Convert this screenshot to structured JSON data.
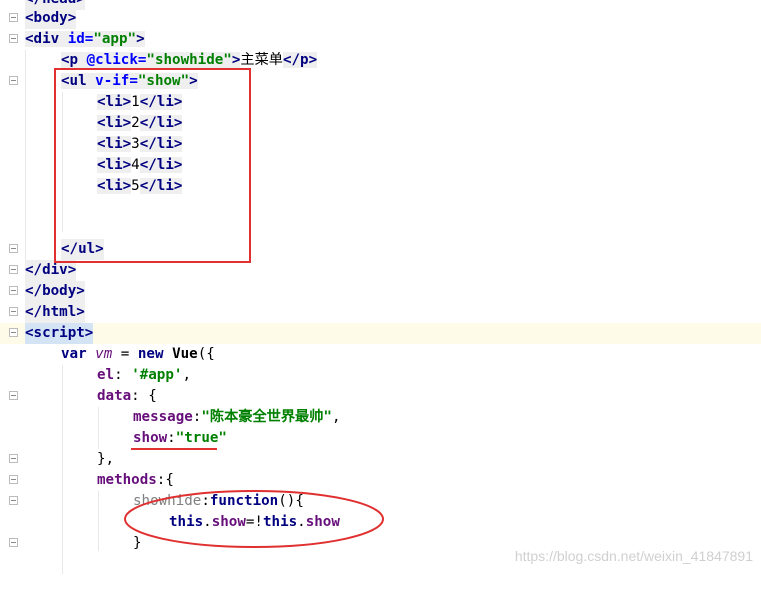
{
  "lines": {
    "l0": "</head>",
    "l1_open": "<body>",
    "l2": {
      "open": "<div ",
      "attr": "id=",
      "val": "\"app\"",
      "close": ">"
    },
    "l3": {
      "open": "<p ",
      "attr": "@click=",
      "val": "\"showhide\"",
      "close": ">",
      "text": "主菜单",
      "end": "</p>"
    },
    "l4": {
      "open": "<ul ",
      "attr": "v-if=",
      "val": "\"show\"",
      "close": ">"
    },
    "li": [
      {
        "open": "<li>",
        "num": "1",
        "close": "</li>"
      },
      {
        "open": "<li>",
        "num": "2",
        "close": "</li>"
      },
      {
        "open": "<li>",
        "num": "3",
        "close": "</li>"
      },
      {
        "open": "<li>",
        "num": "4",
        "close": "</li>"
      },
      {
        "open": "<li>",
        "num": "5",
        "close": "</li>"
      }
    ],
    "ul_close": "</ul>",
    "div_close": "</div>",
    "body_close": "</body>",
    "html_close": "</html>",
    "script_open": "<script>",
    "var_kw": "var ",
    "var_name": "vm",
    "var_eq": " = ",
    "new_kw": "new ",
    "vue": "Vue",
    "vue_paren": "({",
    "el_key": "el",
    "el_colon": ": ",
    "el_val": "'#app'",
    "el_comma": ",",
    "data_key": "data",
    "data_rest": ": {",
    "message_key": "message",
    "message_colon": ":",
    "message_val": "\"陈本豪全世界最帅\"",
    "message_comma": ",",
    "show_key": "show",
    "show_colon": ":",
    "show_val": "\"true\"",
    "data_close": "},",
    "methods_key": "methods",
    "methods_rest": ":{",
    "showhide_key": "showhide",
    "showhide_colon": ":",
    "function_kw": "function",
    "function_rest": "(){",
    "this1": "this",
    "dot1": ".",
    "show1": "show",
    "assign": "=!",
    "this2": "this",
    "dot2": ".",
    "show2": "show",
    "brace_close": "}"
  },
  "watermark": "https://blog.csdn.net/weixin_41847891",
  "colors": {
    "annotation": "#e03030",
    "tag": "#000080",
    "string": "#008000",
    "attr": "#0000ff",
    "prop": "#660e7a"
  }
}
